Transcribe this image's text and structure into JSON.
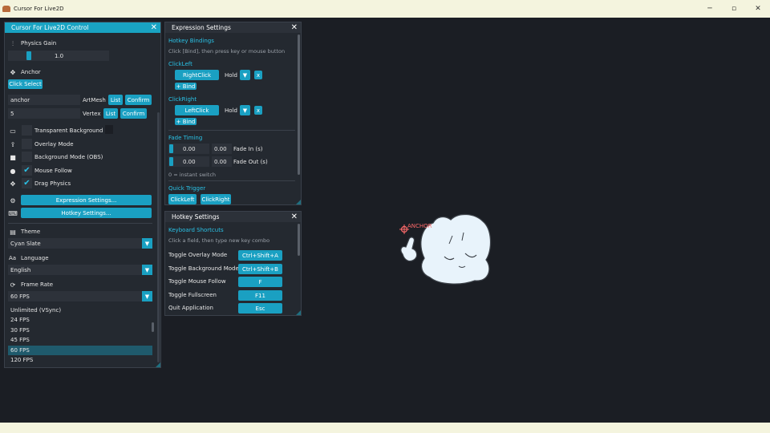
{
  "window": {
    "title": "Cursor For Live2D",
    "min_icon": "minimize-icon",
    "max_icon": "maximize-icon",
    "close_icon": "close-icon"
  },
  "control": {
    "title": "Cursor For Live2D Control",
    "physics_gain_label": "Physics Gain",
    "physics_gain_value": "1.0",
    "anchor_label": "Anchor",
    "click_select": "Click Select",
    "artmesh_value": "anchor",
    "artmesh_label": "ArtMesh",
    "vertex_value": "5",
    "vertex_label": "Vertex",
    "list": "List",
    "confirm": "Confirm",
    "toggles": [
      {
        "label": "Transparent Background",
        "checked": false
      },
      {
        "label": "Overlay Mode",
        "checked": false
      },
      {
        "label": "Background Mode (OBS)",
        "checked": false
      },
      {
        "label": "Mouse Follow",
        "checked": true
      },
      {
        "label": "Drag Physics",
        "checked": true
      }
    ],
    "expression_settings_btn": "Expression Settings...",
    "hotkey_settings_btn": "Hotkey Settings...",
    "theme_label": "Theme",
    "theme_value": "Cyan Slate",
    "language_label": "Language",
    "language_icon_text": "Aa",
    "language_value": "English",
    "frame_rate_label": "Frame Rate",
    "frame_rate_value": "60 FPS",
    "fps_options": [
      "Unlimited (VSync)",
      "24 FPS",
      "30 FPS",
      "45 FPS",
      "60 FPS",
      "120 FPS"
    ],
    "fps_selected": "60 FPS"
  },
  "expression": {
    "title": "Expression Settings",
    "hotkey_bindings": "Hotkey Bindings",
    "hint": "Click [Bind], then press key or mouse button",
    "click_left_label": "ClickLeft",
    "click_left_bind": "RightClick",
    "click_right_label": "ClickRight",
    "click_right_bind": "LeftClick",
    "mode": "Hold",
    "x": "x",
    "add_bind": "+ Bind",
    "fade_timing": "Fade Timing",
    "fade_in_value": "0.00",
    "fade_in_value2": "0.00",
    "fade_in_label": "Fade In (s)",
    "fade_out_value": "0.00",
    "fade_out_value2": "0.00",
    "fade_out_label": "Fade Out (s)",
    "instant_hint": "0 = instant switch",
    "quick_trigger": "Quick Trigger",
    "quick_left": "ClickLeft",
    "quick_right": "ClickRight"
  },
  "hotkey": {
    "title": "Hotkey Settings",
    "keyboard_shortcuts": "Keyboard Shortcuts",
    "hint": "Click a field, then type new key combo",
    "rows": [
      {
        "label": "Toggle Overlay Mode",
        "key": "Ctrl+Shift+A"
      },
      {
        "label": "Toggle Background Mode",
        "key": "Ctrl+Shift+B"
      },
      {
        "label": "Toggle Mouse Follow",
        "key": "F"
      },
      {
        "label": "Toggle Fullscreen",
        "key": "F11"
      },
      {
        "label": "Quit Application",
        "key": "Esc"
      }
    ]
  },
  "character": {
    "anchor_label": "ANCHOR"
  },
  "colors": {
    "accent": "#1aa0c2",
    "section": "#2ac2e6",
    "bg": "#1b1e24",
    "panel": "#242930",
    "titlebar": "#f4f4de",
    "anchor": "#ff6a6a"
  }
}
